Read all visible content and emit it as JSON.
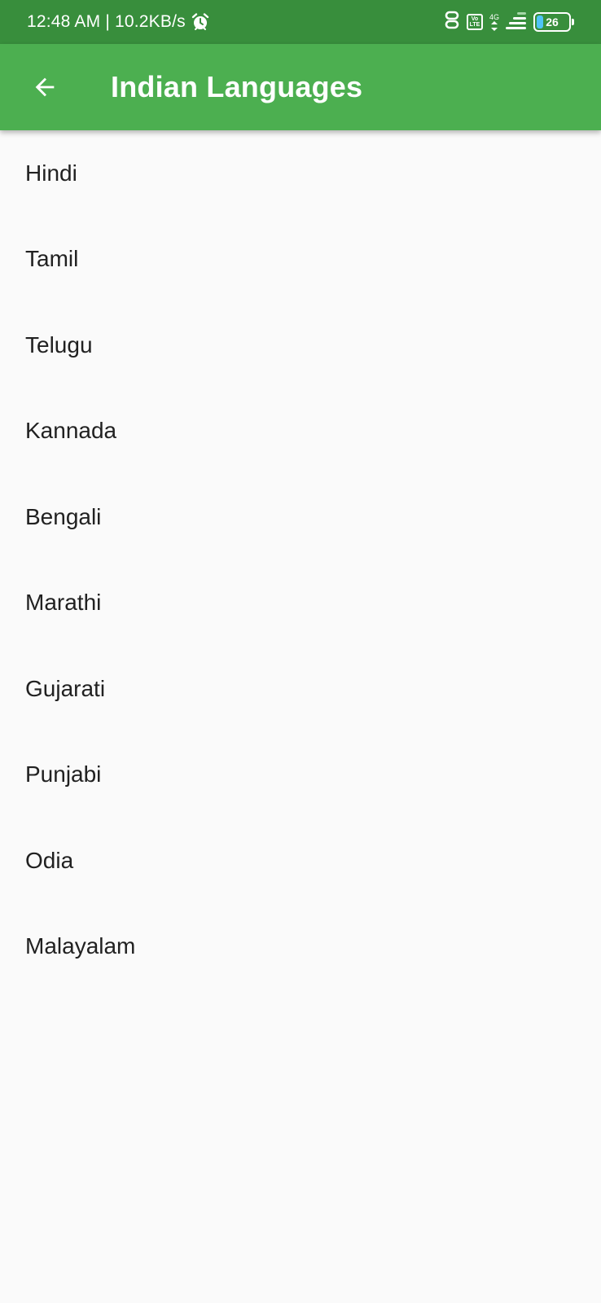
{
  "status_bar": {
    "time": "12:48 AM",
    "separator": "|",
    "network_speed": "10.2KB/s",
    "network_type": "4G",
    "volte_top": "Vo",
    "volte_bottom": "LTE",
    "battery_level": "26",
    "icons": [
      "alarm-icon",
      "data-saver-icon",
      "volte-icon",
      "mobile-data-arrows-icon",
      "signal-icon",
      "battery-icon"
    ]
  },
  "app_bar": {
    "title": "Indian Languages",
    "back_icon": "arrow-back-icon",
    "background_color": "#4caf50",
    "status_bar_color": "#388e3c"
  },
  "languages": [
    "Hindi",
    "Tamil",
    "Telugu",
    "Kannada",
    "Bengali",
    "Marathi",
    "Gujarati",
    "Punjabi",
    "Odia",
    "Malayalam"
  ]
}
